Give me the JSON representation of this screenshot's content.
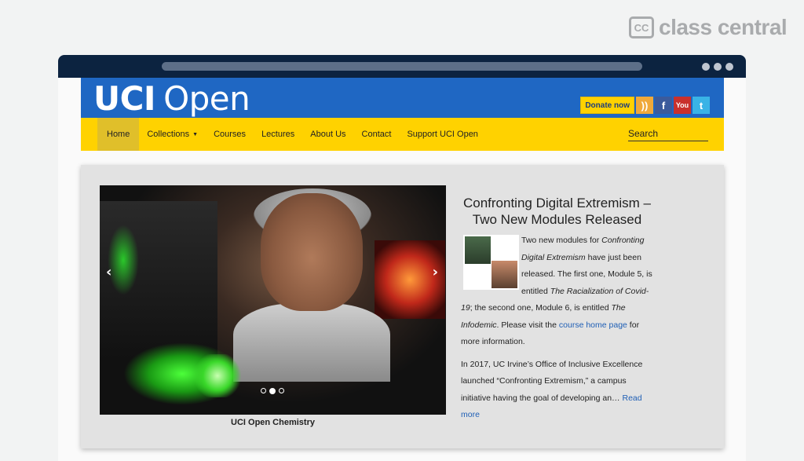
{
  "watermark": {
    "icon_text": "CC",
    "text": "class central"
  },
  "site": {
    "logo_bold": "UCI",
    "logo_light": "Open",
    "donate_label": "Donate now",
    "social": [
      {
        "name": "rss",
        "glyph": "))"
      },
      {
        "name": "facebook",
        "glyph": "f"
      },
      {
        "name": "youtube",
        "glyph": "You"
      },
      {
        "name": "twitter",
        "glyph": "t"
      }
    ]
  },
  "nav": {
    "items": [
      "Home",
      "Collections",
      "Courses",
      "Lectures",
      "About Us",
      "Contact",
      "Support UCI Open"
    ],
    "search_placeholder": "Search"
  },
  "slider": {
    "caption": "UCI Open Chemistry",
    "prev": "‹",
    "next": "›",
    "active_index": 1,
    "count": 3
  },
  "article": {
    "title": "Confronting Digital Extremism – Two New Modules Released",
    "p1": {
      "t1": "Two new modules for ",
      "i1": "Confronting Digital Extremism",
      "t2": " have just been released. The first one, Module 5, is entitled ",
      "i2": "The Racialization of Covid-19",
      "t3": "; the second one, Module 6, is entitled ",
      "i3": "The Infodemic",
      "t4": ". Please visit the ",
      "link": "course home page",
      "t5": " for more information."
    },
    "p2": {
      "text": "In 2017, UC Irvine’s Office of Inclusive Excellence launched “Confronting Extremism,” a campus initiative having the goal of developing an… ",
      "link": "Read more"
    }
  },
  "colors": {
    "header_blue": "#1f67c3",
    "nav_yellow": "#ffd200",
    "link_blue": "#1f5fb5",
    "browser_bar": "#0c2340"
  }
}
